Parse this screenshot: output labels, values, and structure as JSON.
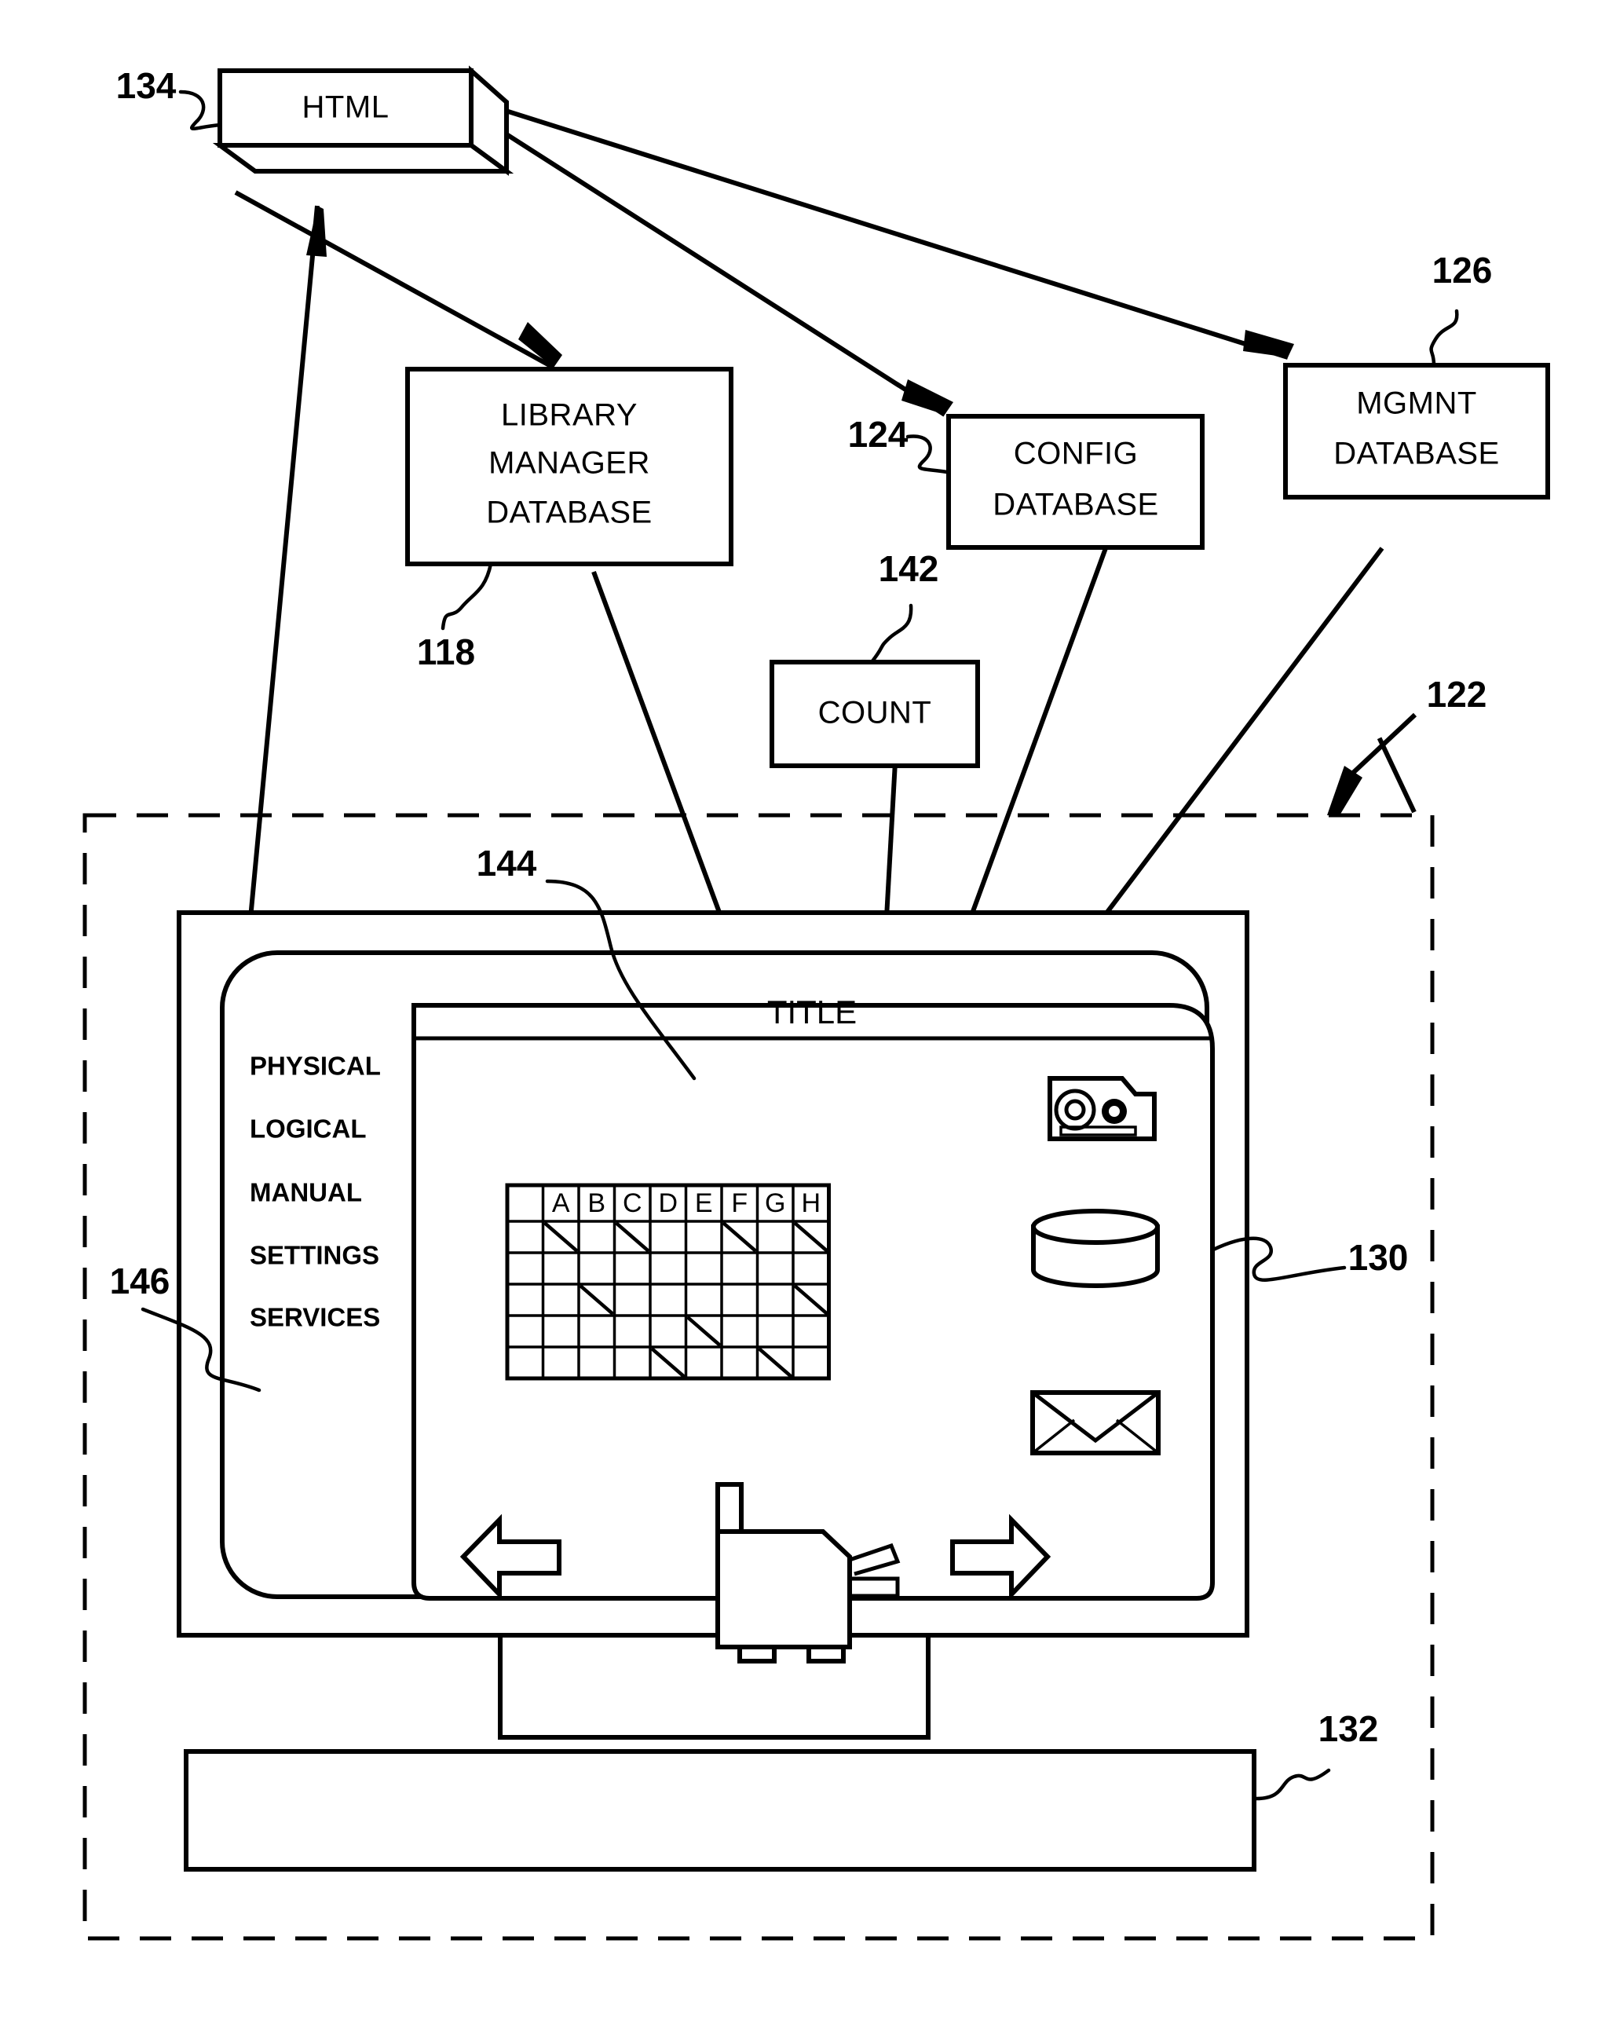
{
  "figure": {
    "title": "Patent figure: HTML-driven library management user interface",
    "boxes": {
      "html": "HTML",
      "library_manager_database": [
        "LIBRARY",
        "MANAGER",
        "DATABASE"
      ],
      "config_database": [
        "CONFIG",
        "DATABASE"
      ],
      "mgmnt_database": [
        "MGMNT",
        "DATABASE"
      ],
      "count": "COUNT"
    },
    "reference_numerals": {
      "html_box": "134",
      "library_manager_database": "118",
      "config_database": "124",
      "mgmnt_database": "126",
      "count_box": "142",
      "system_boundary": "122",
      "display_area": "130",
      "keyboard": "132",
      "browser_window": "144",
      "menu_panel": "146"
    },
    "screen": {
      "title_label": "TITLE",
      "menu_items": [
        "PHYSICAL",
        "LOGICAL",
        "MANUAL",
        "SETTINGS",
        "SERVICES"
      ],
      "grid": {
        "column_headers": [
          "",
          "A",
          "B",
          "C",
          "D",
          "E",
          "F",
          "G",
          "H"
        ],
        "row_count": 5,
        "slashed_cells": [
          [
            1,
            1
          ],
          [
            1,
            3
          ],
          [
            1,
            6
          ],
          [
            1,
            8
          ],
          [
            3,
            2
          ],
          [
            3,
            8
          ],
          [
            4,
            5
          ],
          [
            5,
            4
          ],
          [
            5,
            7
          ]
        ]
      },
      "icons": {
        "tape_cartridge": "tape-cartridge-icon",
        "disk_storage": "disk-cylinder-icon",
        "mail": "envelope-icon",
        "nav_back": "left-arrow-icon",
        "nav_forward": "right-arrow-icon",
        "robot_accessor": "tape-accessor-icon"
      }
    },
    "colors": {
      "line": "#000000",
      "background": "#ffffff"
    }
  }
}
